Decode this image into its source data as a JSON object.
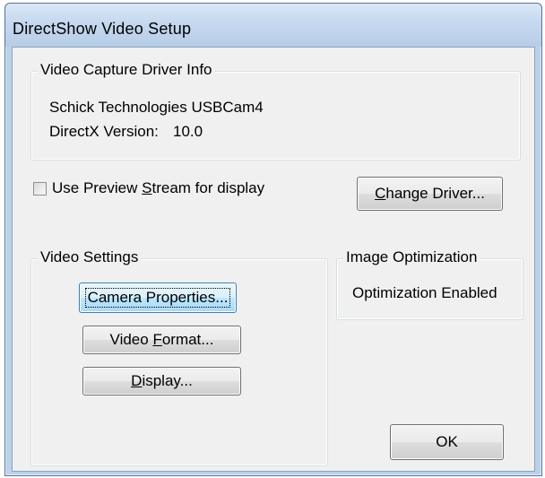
{
  "window": {
    "title": "DirectShow Video Setup"
  },
  "driver_info": {
    "group_label": "Video Capture Driver Info",
    "driver_name": "Schick Technologies USBCam4",
    "directx_label": "DirectX Version:",
    "directx_version": "10.0"
  },
  "preview": {
    "checkbox_label_pre": "Use Preview ",
    "checkbox_label_accel": "S",
    "checkbox_label_post": "tream for display",
    "checked": false
  },
  "change_driver": {
    "label_accel": "C",
    "label_rest": "hange Driver..."
  },
  "video_settings": {
    "group_label": "Video Settings",
    "camera_properties": "Camera Properties...",
    "video_format_pre": "Video ",
    "video_format_accel": "F",
    "video_format_post": "ormat...",
    "display_accel": "D",
    "display_post": "isplay..."
  },
  "image_optimization": {
    "group_label": "Image Optimization",
    "status": "Optimization Enabled"
  },
  "ok_button": {
    "label": "OK"
  }
}
